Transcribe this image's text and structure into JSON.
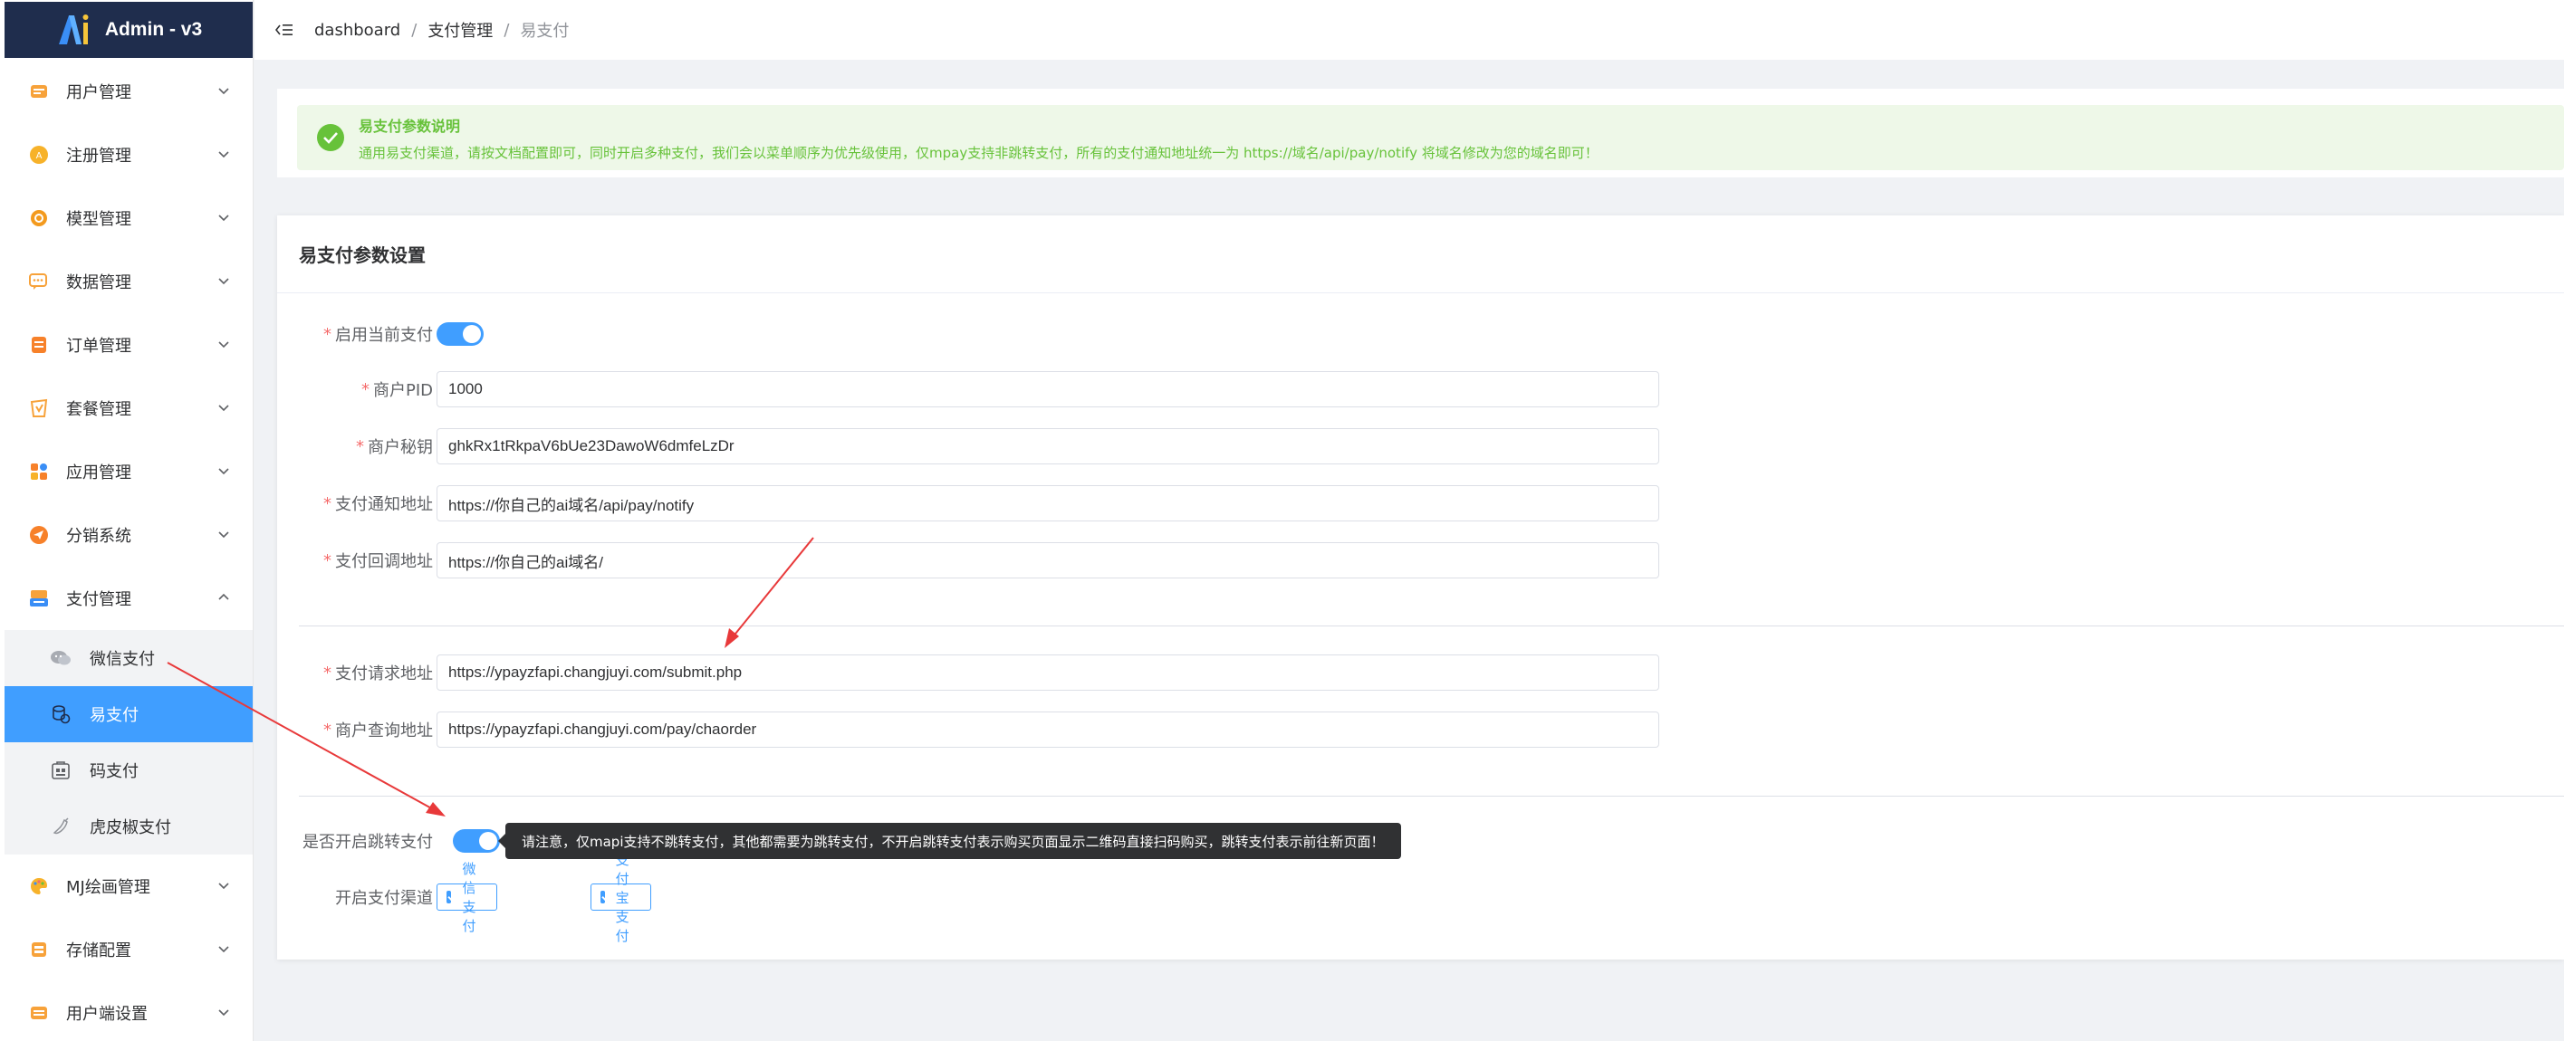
{
  "app": {
    "title": "Admin - v3"
  },
  "sidebar": {
    "items": [
      {
        "label": "用户管理",
        "icon": "user-card-icon"
      },
      {
        "label": "注册管理",
        "icon": "register-badge-icon"
      },
      {
        "label": "模型管理",
        "icon": "model-gear-icon"
      },
      {
        "label": "数据管理",
        "icon": "chat-data-icon"
      },
      {
        "label": "订单管理",
        "icon": "order-list-icon"
      },
      {
        "label": "套餐管理",
        "icon": "package-icon"
      },
      {
        "label": "应用管理",
        "icon": "apps-grid-icon"
      },
      {
        "label": "分销系统",
        "icon": "send-plane-icon"
      },
      {
        "label": "支付管理",
        "icon": "payment-terminal-icon"
      }
    ],
    "pay_sub": [
      {
        "label": "微信支付",
        "icon": "wechat-icon"
      },
      {
        "label": "易支付",
        "icon": "coins-icon"
      },
      {
        "label": "码支付",
        "icon": "qr-pay-icon"
      },
      {
        "label": "虎皮椒支付",
        "icon": "pepper-icon"
      }
    ],
    "items_after": [
      {
        "label": "MJ绘画管理",
        "icon": "palette-icon"
      },
      {
        "label": "存储配置",
        "icon": "storage-icon"
      },
      {
        "label": "用户端设置",
        "icon": "client-settings-icon"
      }
    ]
  },
  "header": {
    "breadcrumb": [
      "dashboard",
      "支付管理",
      "易支付"
    ],
    "separator": "/"
  },
  "alert": {
    "title": "易支付参数说明",
    "description": "通用易支付渠道，请按文档配置即可，同时开启多种支付，我们会以菜单顺序为优先级使用，仅mpay支持非跳转支付，所有的支付通知地址统一为 https://域名/api/pay/notify 将域名修改为您的域名即可！"
  },
  "card": {
    "title": "易支付参数设置",
    "fields": {
      "enable": {
        "label": "启用当前支付",
        "on": true
      },
      "pid": {
        "label": "商户PID",
        "value": "1000"
      },
      "secret": {
        "label": "商户秘钥",
        "value": "ghkRx1tRkpaV6bUe23DawoW6dmfeLzDr"
      },
      "notify": {
        "label": "支付通知地址",
        "value": "https://你自己的ai域名/api/pay/notify"
      },
      "return": {
        "label": "支付回调地址",
        "value": "https://你自己的ai域名/"
      },
      "api": {
        "label": "支付请求地址",
        "value": "https://ypayzfapi.changjuyi.com/submit.php"
      },
      "query": {
        "label": "商户查询地址",
        "value": "https://ypayzfapi.changjuyi.com/pay/chaorder"
      },
      "redirect": {
        "label": "是否开启跳转支付",
        "on": true,
        "tooltip": "请注意，仅mapi支持不跳转支付，其他都需要为跳转支付，不开启跳转支付表示购买页面显示二维码直接扫码购买，跳转支付表示前往新页面！"
      },
      "channels": {
        "label": "开启支付渠道",
        "options": [
          "微信支付",
          "支付宝支付"
        ]
      }
    }
  },
  "colors": {
    "primary": "#409eff",
    "logo_bg": "#1f2d4d",
    "success": "#67c23a",
    "required": "#f56c6c",
    "annotation": "#e8393a"
  }
}
